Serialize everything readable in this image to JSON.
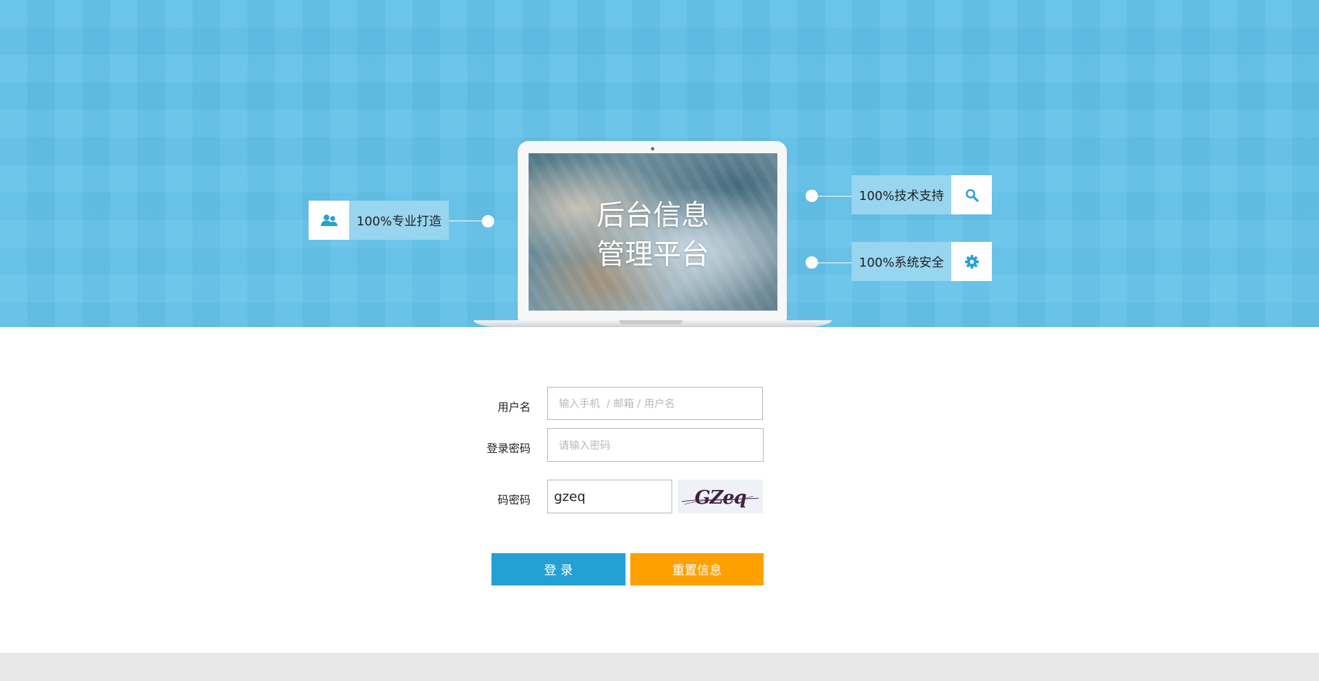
{
  "banner": {
    "screen_title_line1": "后台信息",
    "screen_title_line2": "管理平台",
    "features": {
      "left": {
        "label": "100%专业打造",
        "icon": "users-icon"
      },
      "right_top": {
        "label": "100%技术支持",
        "icon": "search-icon"
      },
      "right_bottom": {
        "label": "100%系统安全",
        "icon": "gear-icon"
      }
    }
  },
  "form": {
    "username": {
      "label": "用户名",
      "placeholder": "输入手机  / 邮箱 / 用户名",
      "value": ""
    },
    "password": {
      "label": "登录密码",
      "placeholder": "请输入密码",
      "value": ""
    },
    "captcha": {
      "label": "码密码",
      "value": "gzeq",
      "image_text": "GZeq"
    },
    "login_label": "登 录",
    "reset_label": "重置信息"
  },
  "colors": {
    "banner_bg": "#62c0e8",
    "feature_label_bg": "#98d5ef",
    "icon_color": "#2a9fd6",
    "login_button": "#24a0d5",
    "reset_button": "#fea100",
    "footer_bg": "#e7e7e7"
  }
}
